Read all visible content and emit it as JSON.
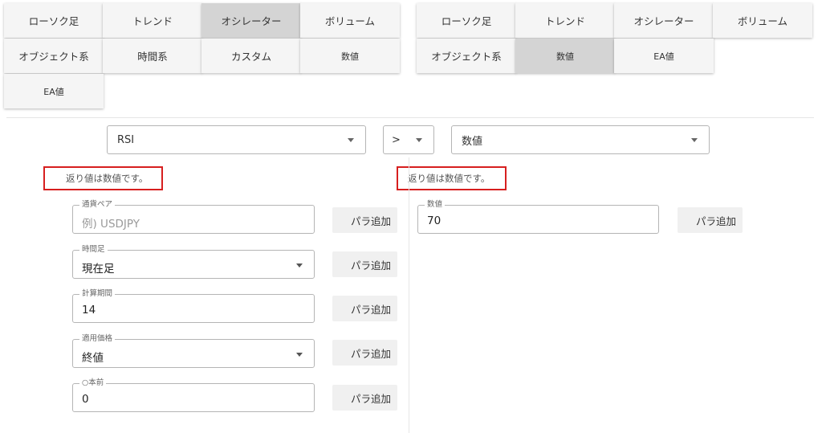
{
  "left_tabs": [
    {
      "label": "ローソク足",
      "selected": false
    },
    {
      "label": "トレンド",
      "selected": false
    },
    {
      "label": "オシレーター",
      "selected": true
    },
    {
      "label": "ボリューム",
      "selected": false
    },
    {
      "label": "オブジェクト系",
      "selected": false
    },
    {
      "label": "時間系",
      "selected": false
    },
    {
      "label": "カスタム",
      "selected": false
    },
    {
      "label": "数値",
      "selected": false
    },
    {
      "label": "EA値",
      "selected": false
    }
  ],
  "right_tabs": [
    {
      "label": "ローソク足",
      "selected": false
    },
    {
      "label": "トレンド",
      "selected": false
    },
    {
      "label": "オシレーター",
      "selected": false
    },
    {
      "label": "ボリューム",
      "selected": false
    },
    {
      "label": "オブジェクト系",
      "selected": false
    },
    {
      "label": "数値",
      "selected": true
    },
    {
      "label": "EA値",
      "selected": false
    }
  ],
  "condition": {
    "left_select": "RSI",
    "operator": ">",
    "right_select": "数値"
  },
  "left_panel": {
    "note": "返り値は数値です。",
    "fields": [
      {
        "label": "通貨ペア",
        "value": "",
        "placeholder": "例) USDJPY",
        "dropdown": false
      },
      {
        "label": "時間足",
        "value": "現在足",
        "placeholder": "",
        "dropdown": true
      },
      {
        "label": "計算期間",
        "value": "14",
        "placeholder": "",
        "dropdown": false
      },
      {
        "label": "適用価格",
        "value": "終値",
        "placeholder": "",
        "dropdown": true
      },
      {
        "label": "○本前",
        "value": "0",
        "placeholder": "",
        "dropdown": false
      }
    ],
    "add_param_label": "パラ追加"
  },
  "right_panel": {
    "note": "返り値は数値です。",
    "fields": [
      {
        "label": "数値",
        "value": "70",
        "placeholder": "",
        "dropdown": false
      }
    ],
    "add_param_label": "パラ追加"
  },
  "colors": {
    "highlight_border": "#d71f1f",
    "selected_tab": "#d4d4d4",
    "tab_bg": "#f5f5f5"
  }
}
